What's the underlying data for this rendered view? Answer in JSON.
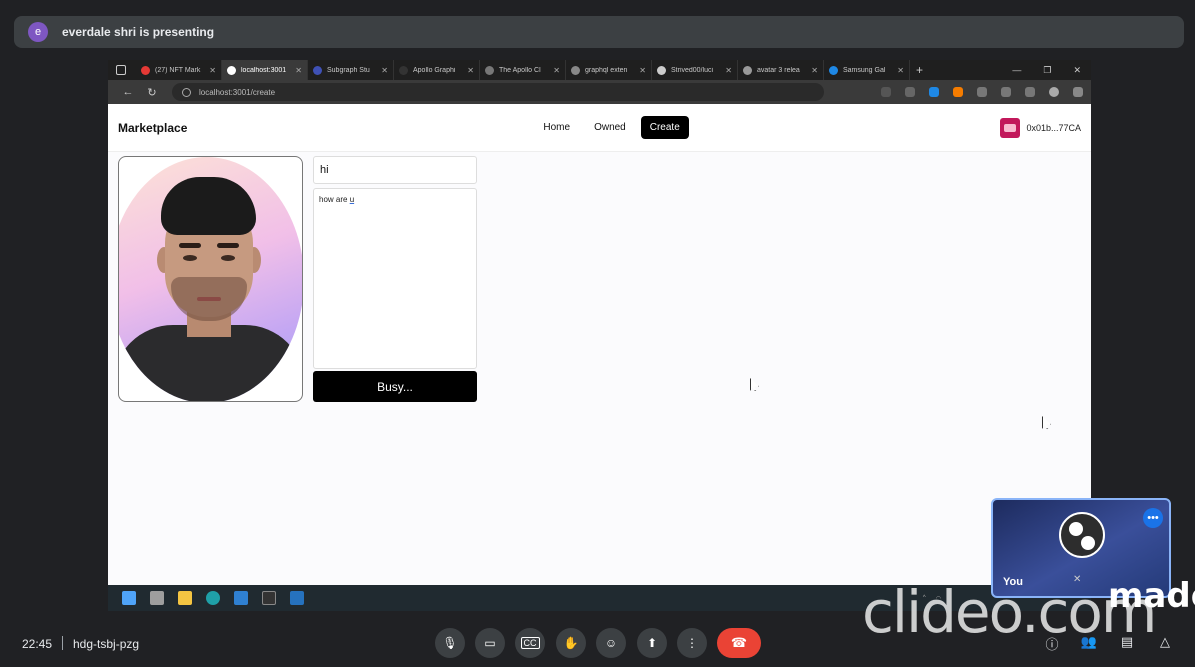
{
  "meet": {
    "presenter_initial": "e",
    "presenter_text": "everdale shri is presenting",
    "time": "22:45",
    "meeting_code": "hdg-tsbj-pzg",
    "self_label": "You",
    "controls": [
      "mic-icon",
      "camera-icon",
      "captions-icon",
      "raise-hand-icon",
      "emoji-icon",
      "present-icon",
      "more-options-icon"
    ],
    "end_call_icon": "end-call-icon"
  },
  "browser": {
    "tabs": [
      {
        "label": "(27) NFT Mark",
        "color": "#e53935"
      },
      {
        "label": "localhost:3001",
        "color": "#ffffff",
        "active": true
      },
      {
        "label": "Subgraph Stu",
        "color": "#3f51b5"
      },
      {
        "label": "Apollo Graphi",
        "color": "#333333"
      },
      {
        "label": "The Apollo Cl",
        "color": "#777777"
      },
      {
        "label": "graphql exten",
        "color": "#888888"
      },
      {
        "label": "Strived00/luci",
        "color": "#cccccc"
      },
      {
        "label": "avatar 3 relea",
        "color": "#999999"
      },
      {
        "label": "Samsung Gal",
        "color": "#1e88e5"
      }
    ],
    "url": "localhost:3001/create"
  },
  "app": {
    "brand": "Marketplace",
    "nav": [
      {
        "label": "Home",
        "active": false
      },
      {
        "label": "Owned",
        "active": false
      },
      {
        "label": "Create",
        "active": true
      }
    ],
    "wallet_address": "0x01b...77CA",
    "form": {
      "name_value": "hi",
      "description_prefix": "how are ",
      "description_word": "u",
      "submit_label": "Busy..."
    }
  },
  "watermark": {
    "text": "clideo.com",
    "made": "made"
  },
  "colors": {
    "meet_bg": "#202124",
    "end_call": "#ea4335",
    "accent_blue": "#1a73e8"
  }
}
